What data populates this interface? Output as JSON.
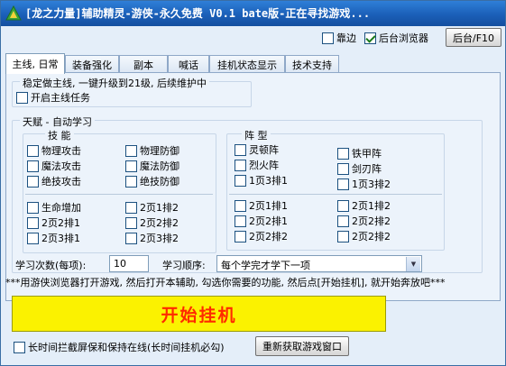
{
  "window": {
    "title": "[龙之力量]辅助精灵-游侠-永久免费  V0.1 bate版-正在寻找游戏...",
    "app_icon": "leaf-logo-icon"
  },
  "toolbar": {
    "dock_label": "靠边",
    "dock_checked": false,
    "background_browser_label": "后台浏览器",
    "background_browser_checked": true,
    "background_hotkey_label": "后台/F10"
  },
  "tabs": [
    {
      "label": "主线, 日常",
      "active": true
    },
    {
      "label": "装备强化",
      "active": false
    },
    {
      "label": "副本",
      "active": false
    },
    {
      "label": "喊话",
      "active": false
    },
    {
      "label": "挂机状态显示",
      "active": false
    },
    {
      "label": "技术支持",
      "active": false
    }
  ],
  "main_quest": {
    "group_title": "稳定做主线, 一键升级到21级, 后续维护中",
    "enable_label": "开启主线任务",
    "enable_checked": false
  },
  "talent": {
    "group_title": "天赋 - 自动学习",
    "skills_title": "技  能",
    "skills": [
      [
        "物理攻击",
        "物理防御"
      ],
      [
        "魔法攻击",
        "魔法防御"
      ],
      [
        "绝技攻击",
        "绝技防御"
      ]
    ],
    "skills_lower": [
      [
        "生命增加",
        "2页1排2"
      ],
      [
        "2页2排1",
        "2页2排2"
      ],
      [
        "2页3排1",
        "2页3排2"
      ]
    ],
    "formation_title": "阵  型",
    "formation_left": [
      "灵顿阵",
      "烈火阵",
      "1页3排1"
    ],
    "formation_right": [
      "铁甲阵",
      "剑刃阵",
      "1页3排2"
    ],
    "formation_lower": [
      [
        "2页1排1",
        "2页1排2"
      ],
      [
        "2页2排1",
        "2页2排2"
      ],
      [
        "2页2排2",
        "2页2排2"
      ]
    ],
    "learn_count_label": "学习次数(每项):",
    "learn_count_value": "10",
    "learn_order_label": "学习顺序:",
    "learn_order_value": "每个学完才学下一项"
  },
  "notice": "***用游侠浏览器打开游戏, 然后打开本辅助, 勾选你需要的功能, 然后点[开始挂机], 就开始奔放吧***",
  "start_button_label": "开始挂机",
  "bottom": {
    "screensaver_label": "长时间拦截屏保和保持在线(长时间挂机必勾)",
    "screensaver_checked": false,
    "refresh_label": "重新获取游戏窗口"
  },
  "colors": {
    "title_bar": "#1b5fb8",
    "start_button_bg": "#fbf200",
    "start_button_text": "#ff2a00"
  }
}
